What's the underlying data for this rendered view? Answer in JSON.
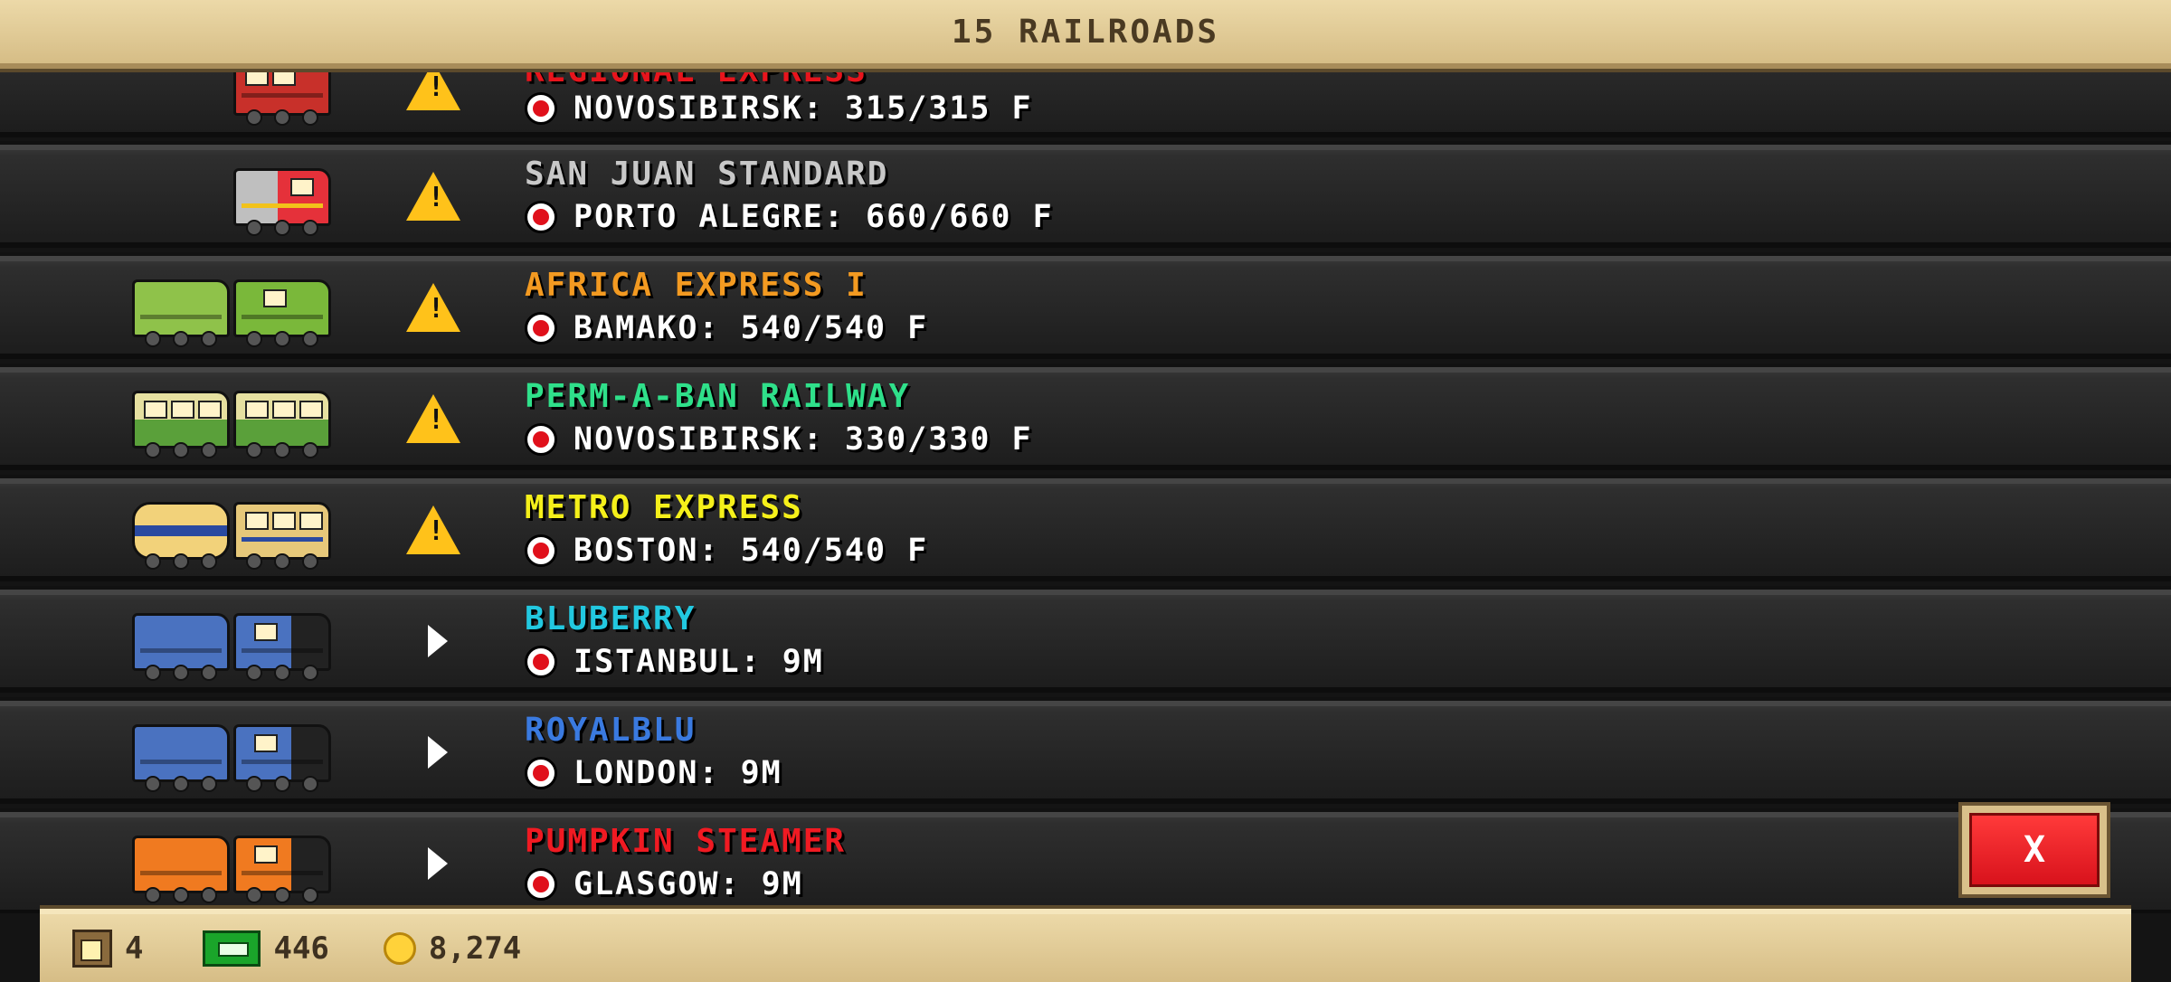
{
  "header": {
    "title": "15 RAILROADS"
  },
  "rows": [
    {
      "name": "REGIONAL EXPRESS",
      "name_color": "#e8141c",
      "destination": "NOVOSIBIRSK: 315/315 F",
      "status": "warning-icon",
      "locos": [
        "#c8302a"
      ]
    },
    {
      "name": "SAN JUAN STANDARD",
      "name_color": "#c8c8c8",
      "destination": "PORTO ALEGRE: 660/660 F",
      "status": "warning-icon",
      "locos": [
        "#e5313a"
      ]
    },
    {
      "name": "AFRICA EXPRESS I",
      "name_color": "#f39a21",
      "destination": "BAMAKO: 540/540 F",
      "status": "warning-icon",
      "locos": [
        "#8fc24a",
        "#7ab83a"
      ]
    },
    {
      "name": "PERM-A-BAN RAILWAY",
      "name_color": "#2fe08a",
      "destination": "NOVOSIBIRSK: 330/330 F",
      "status": "warning-icon",
      "locos": [
        "#d9d27a",
        "#d9d27a"
      ]
    },
    {
      "name": "METRO EXPRESS",
      "name_color": "#f5f01a",
      "destination": "BOSTON: 540/540 F",
      "status": "warning-icon",
      "locos": [
        "#f2d27a",
        "#e6c87a"
      ]
    },
    {
      "name": "BLUBERRY",
      "name_color": "#22c8e0",
      "destination": "ISTANBUL: 9M",
      "status": "play-icon",
      "locos": [
        "#4a72c0",
        "#4a72c0"
      ]
    },
    {
      "name": "ROYALBLU",
      "name_color": "#3a7ae0",
      "destination": "LONDON: 9M",
      "status": "play-icon",
      "locos": [
        "#4a72c0",
        "#4a72c0"
      ]
    },
    {
      "name": "PUMPKIN STEAMER",
      "name_color": "#f01a22",
      "destination": "GLASGOW: 9M",
      "status": "play-icon",
      "locos": [
        "#f07a20",
        "#f07a20"
      ]
    }
  ],
  "close_button": {
    "label": "X"
  },
  "footer": {
    "tickets": "4",
    "cash": "446",
    "coins": "8,274"
  }
}
